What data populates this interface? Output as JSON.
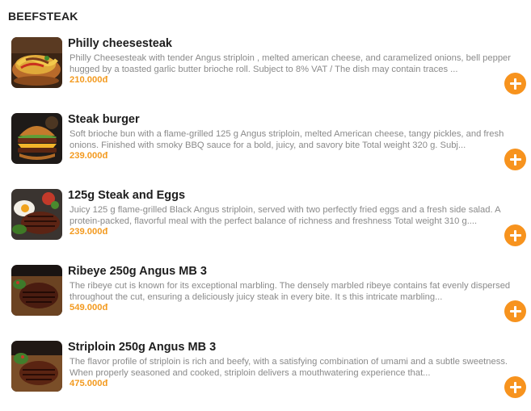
{
  "section": {
    "title": "BEEFSTEAK"
  },
  "items": [
    {
      "name": "Philly cheesesteak",
      "description": "Philly Cheesesteak with tender Angus striploin , melted american cheese, and caramelized onions, bell pepper hugged by a toasted garlic butter brioche roll. Subject to 8% VAT / The dish may contain traces ...",
      "price": "210.000đ",
      "image_icon": "philly-cheesesteak-photo"
    },
    {
      "name": "Steak burger",
      "description": "Soft brioche bun with a flame-grilled 125 g Angus striploin, melted American cheese, tangy pickles, and fresh onions. Finished with smoky BBQ sauce for a bold, juicy, and savory bite Total weight 320 g. Subj...",
      "price": "239.000đ",
      "image_icon": "steak-burger-photo"
    },
    {
      "name": "125g Steak and Eggs",
      "description": "Juicy 125 g flame-grilled Black Angus striploin, served with two perfectly fried eggs and a fresh side salad. A protein-packed, flavorful meal with the perfect balance of richness and freshness Total weight 310 g....",
      "price": "239.000đ",
      "image_icon": "steak-and-eggs-photo"
    },
    {
      "name": "Ribeye 250g Angus MB 3",
      "description": "The ribeye cut is known for its exceptional marbling. The densely marbled ribeye contains fat evenly dispersed throughout the cut, ensuring a deliciously juicy steak in every bite. It s this intricate marbling...",
      "price": "549.000đ",
      "image_icon": "ribeye-steak-photo"
    },
    {
      "name": "Striploin 250g Angus MB 3",
      "description": "The flavor profile of striploin is rich and beefy, with a satisfying combination of umami and a subtle sweetness. When properly seasoned and cooked, striploin delivers a mouthwatering experience that...",
      "price": "475.000đ",
      "image_icon": "striploin-steak-photo"
    }
  ],
  "colors": {
    "accent": "#f7931e",
    "price": "#f39a1f",
    "description": "#8a8a8a"
  },
  "add_button_icon": "plus-icon"
}
